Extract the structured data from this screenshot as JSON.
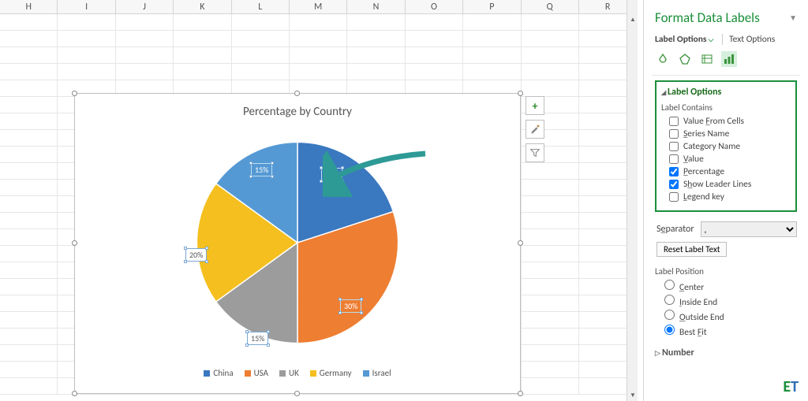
{
  "columns": [
    "H",
    "I",
    "J",
    "K",
    "L",
    "M",
    "N",
    "O",
    "P",
    "Q",
    "R"
  ],
  "row_count": 23,
  "chart_data": {
    "type": "pie",
    "title": "Percentage by Country",
    "categories": [
      "China",
      "USA",
      "UK",
      "Germany",
      "Israel"
    ],
    "values": [
      20,
      30,
      15,
      20,
      15
    ],
    "data_labels": [
      "20%",
      "30%",
      "15%",
      "20%",
      "15%"
    ],
    "colors": [
      "#3a78c0",
      "#ee7e32",
      "#9c9c9c",
      "#f5bf1f",
      "#5599d4"
    ]
  },
  "legend": [
    {
      "label": "China",
      "color": "#3a78c0"
    },
    {
      "label": "USA",
      "color": "#ee7e32"
    },
    {
      "label": "UK",
      "color": "#9c9c9c"
    },
    {
      "label": "Germany",
      "color": "#f5bf1f"
    },
    {
      "label": "Israel",
      "color": "#5599d4"
    }
  ],
  "pane": {
    "title": "Format Data Labels",
    "tab_label_options": "Label Options",
    "tab_text_options": "Text Options",
    "section_label_options": "Label Options",
    "label_contains": "Label Contains",
    "opt_value_from_cells": "Value From Cells",
    "opt_series_name": "Series Name",
    "opt_category_name": "Category Name",
    "opt_value": "Value",
    "opt_percentage": "Percentage",
    "opt_show_leader": "Show Leader Lines",
    "opt_legend_key": "Legend key",
    "separator_label": "Separator",
    "separator_value": ",",
    "reset_label": "Reset Label Text",
    "label_position": "Label Position",
    "pos_center": "Center",
    "pos_inside_end": "Inside End",
    "pos_outside_end": "Outside End",
    "pos_best_fit": "Best Fit",
    "section_number": "Number"
  },
  "logo": {
    "E": "E",
    "T": "T"
  }
}
